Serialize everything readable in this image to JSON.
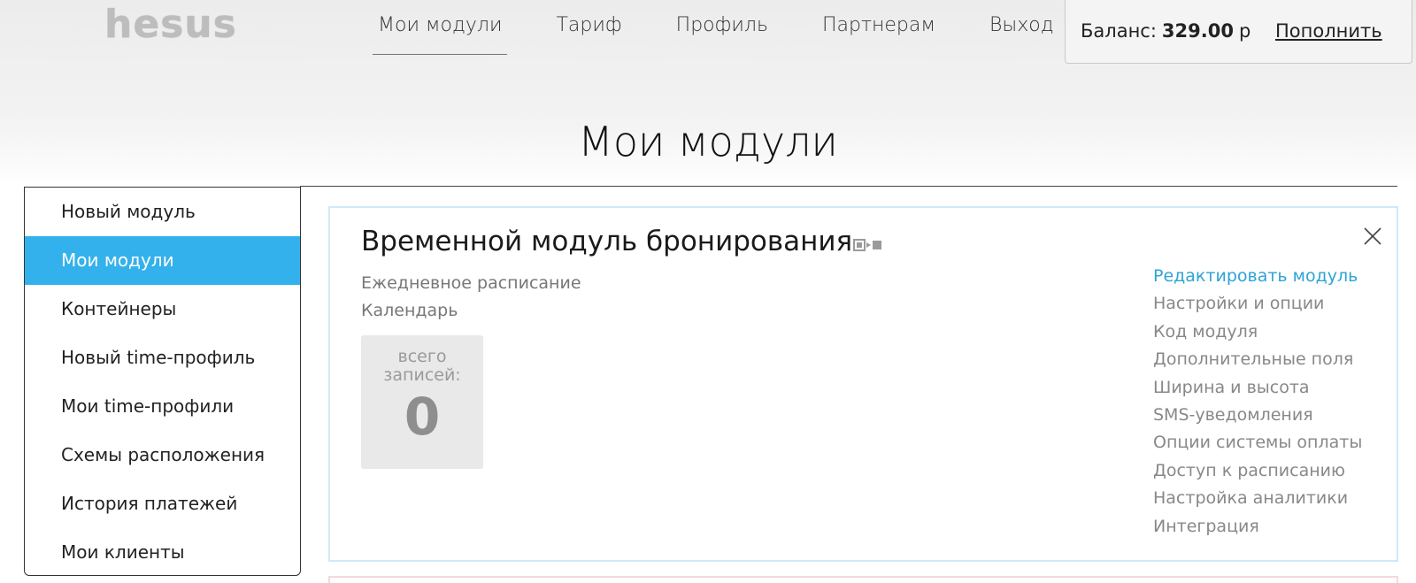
{
  "header": {
    "logo": "hesus",
    "nav": [
      {
        "label": "Мои модули",
        "active": true
      },
      {
        "label": "Тариф"
      },
      {
        "label": "Профиль"
      },
      {
        "label": "Партнерам"
      },
      {
        "label": "Выход"
      }
    ],
    "balance": {
      "label": "Баланс:",
      "amount": "329.00",
      "currency": "р",
      "topup_label": "Пополнить"
    }
  },
  "page_title": "Мои модули",
  "sidebar": {
    "items": [
      {
        "label": "Новый модуль"
      },
      {
        "label": "Мои модули",
        "active": true
      },
      {
        "label": "Контейнеры"
      },
      {
        "label": "Новый time-профиль"
      },
      {
        "label": "Мои time-профили"
      },
      {
        "label": "Схемы расположения"
      },
      {
        "label": "История платежей"
      },
      {
        "label": "Мои клиенты"
      }
    ]
  },
  "module": {
    "title": "Временной модуль бронирования",
    "icon": "module-type-icon",
    "subtitle1": "Ежедневное расписание",
    "subtitle2": "Календарь",
    "counter_label": "всего записей:",
    "counter_value": "0",
    "actions": [
      {
        "label": "Редактировать модуль",
        "primary": true
      },
      {
        "label": "Настройки и опции"
      },
      {
        "label": "Код модуля"
      },
      {
        "label": "Дополнительные поля"
      },
      {
        "label": "Ширина и высота"
      },
      {
        "label": "SMS-уведомления"
      },
      {
        "label": "Опции системы оплаты"
      },
      {
        "label": "Доступ к расписанию"
      },
      {
        "label": "Настройка аналитики"
      },
      {
        "label": "Интеграция"
      }
    ]
  },
  "colors": {
    "accent": "#33b1ec",
    "link_primary": "#2ea3d6",
    "card_border": "#cfe9f7"
  }
}
